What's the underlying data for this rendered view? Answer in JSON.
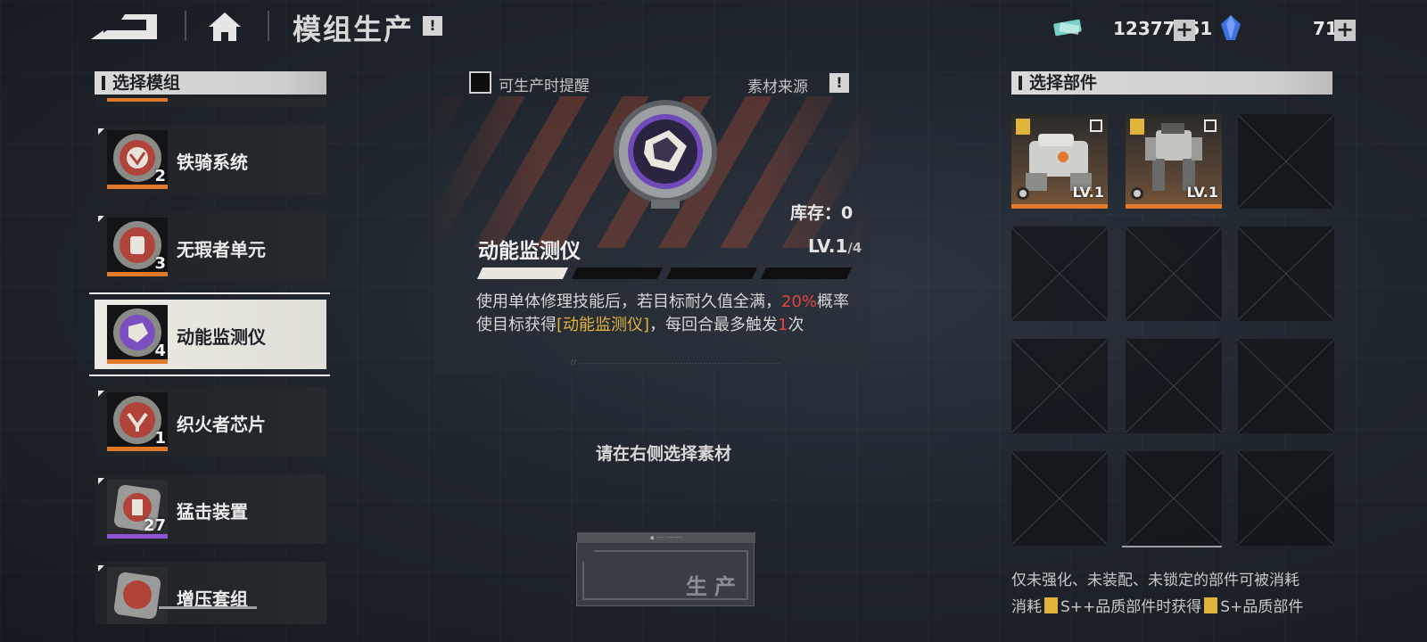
{
  "header": {
    "title": "模组生产",
    "info_mark": "!",
    "currency": [
      {
        "icon": "credit-chip-icon",
        "value": "12377251",
        "plus": "+"
      },
      {
        "icon": "blue-crystal-icon",
        "value": "71",
        "plus": "+"
      }
    ]
  },
  "left": {
    "section_title": "选择模组",
    "modules": [
      {
        "name": "铁骑系统",
        "count": "2",
        "rarity": "orange"
      },
      {
        "name": "无瑕者单元",
        "count": "3",
        "rarity": "orange"
      },
      {
        "name": "动能监测仪",
        "count": "4",
        "rarity": "orange",
        "selected": true
      },
      {
        "name": "织火者芯片",
        "count": "1",
        "rarity": "orange"
      },
      {
        "name": "猛击装置",
        "count": "27",
        "rarity": "purple"
      },
      {
        "name": "增压套组",
        "count": "",
        "rarity": "gray"
      }
    ]
  },
  "center": {
    "remind_label": "可生产时提醒",
    "source_label": "素材来源",
    "source_mark": "!",
    "stock_label": "库存：0",
    "module_title": "动能监测仪",
    "level_main": "LV.1",
    "level_sub": "/4",
    "level_progress": 0.25,
    "desc_1": "使用单体修理技能后，若目标耐久值全满，",
    "desc_pct": "20%",
    "desc_2": "概率使目标获得",
    "desc_tag": "[动能监测仪]",
    "desc_3": "，每回合最多触发",
    "desc_n": "1",
    "desc_4": "次",
    "prompt": "请在右侧选择素材",
    "produce_label": "生产"
  },
  "right": {
    "section_title": "选择部件",
    "parts": [
      {
        "level": "LV.1",
        "rank": "S+"
      },
      {
        "level": "LV.1",
        "rank": "S+"
      }
    ],
    "note_1": "仅未强化、未装配、未锁定的部件可被消耗",
    "note_2a": "消耗",
    "note_2b": "S++品质部件时获得",
    "note_2c": "S+品质部件"
  },
  "colors": {
    "accent_orange": "#e07a2a",
    "accent_purple": "#8f55d6",
    "highlight_gold": "#e5b23a",
    "highlight_red": "#e7433f"
  }
}
